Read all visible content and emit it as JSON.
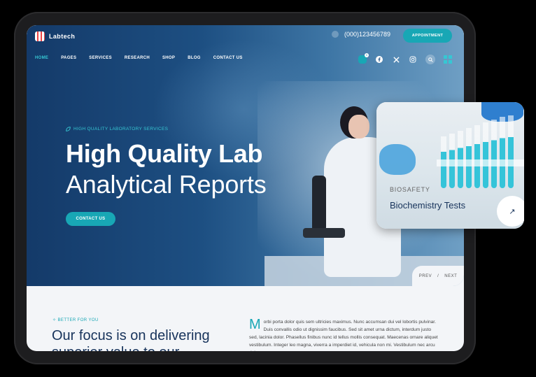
{
  "brand": {
    "name": "Labtech"
  },
  "header": {
    "phone": "(000)123456789",
    "appointment_label": "APPOINTMENT"
  },
  "nav": {
    "items": [
      "HOME",
      "PAGES",
      "SERVICES",
      "RESEARCH",
      "SHOP",
      "BLOG",
      "CONTACT US"
    ],
    "active": "HOME"
  },
  "icons": {
    "cart": "cart-icon",
    "facebook": "facebook-icon",
    "x": "x-icon",
    "instagram": "instagram-icon",
    "search": "search-icon",
    "menu": "grid-menu-icon"
  },
  "cart_count": "0",
  "hero": {
    "tagline": "HIGH QUALITY LABORATORY SERVICES",
    "title_line1": "High Quality Lab",
    "title_line2": "Analytical Reports",
    "cta_label": "CONTACT US",
    "prev_label": "PREV",
    "separator": "/",
    "next_label": "NEXT"
  },
  "section": {
    "eyebrow": "BETTER FOR YOU",
    "heading": "Our focus is on delivering superior value to our",
    "dropcap": "M",
    "paragraph": "orbi porta dolor quis sem ultricies maximus. Nunc accumsan dui vel lobortis pulvinar. Duis convallis odio ut dignissim faucibus. Sed sit amet urna dictum, interdum justo sed, lacinia dolor. Phasellus finibus nunc id tellus mollis consequat. Maecenas ornare aliquet vestibulum. Integer leo magna, viverra a imperdiet id, vehicula non mi. Vestibulum nec arcu dolor."
  },
  "card": {
    "label": "BIOSAFETY",
    "title": "Biochemistry Tests",
    "arrow": "↗"
  },
  "colors": {
    "accent": "#18a7b5",
    "heading": "#17335b",
    "hero": "#1d4f82"
  }
}
